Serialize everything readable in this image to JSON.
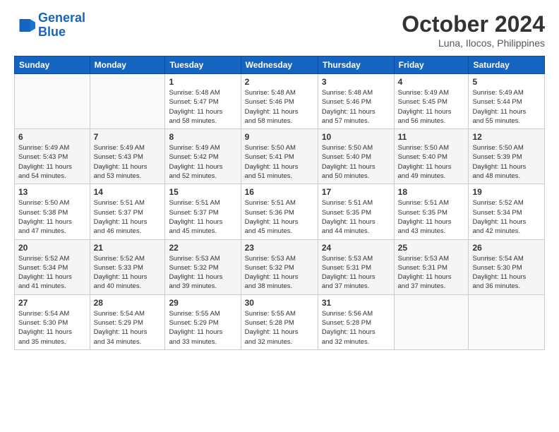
{
  "header": {
    "logo_line1": "General",
    "logo_line2": "Blue",
    "month": "October 2024",
    "location": "Luna, Ilocos, Philippines"
  },
  "weekdays": [
    "Sunday",
    "Monday",
    "Tuesday",
    "Wednesday",
    "Thursday",
    "Friday",
    "Saturday"
  ],
  "weeks": [
    [
      {
        "day": "",
        "info": ""
      },
      {
        "day": "",
        "info": ""
      },
      {
        "day": "1",
        "info": "Sunrise: 5:48 AM\nSunset: 5:47 PM\nDaylight: 11 hours\nand 58 minutes."
      },
      {
        "day": "2",
        "info": "Sunrise: 5:48 AM\nSunset: 5:46 PM\nDaylight: 11 hours\nand 58 minutes."
      },
      {
        "day": "3",
        "info": "Sunrise: 5:48 AM\nSunset: 5:46 PM\nDaylight: 11 hours\nand 57 minutes."
      },
      {
        "day": "4",
        "info": "Sunrise: 5:49 AM\nSunset: 5:45 PM\nDaylight: 11 hours\nand 56 minutes."
      },
      {
        "day": "5",
        "info": "Sunrise: 5:49 AM\nSunset: 5:44 PM\nDaylight: 11 hours\nand 55 minutes."
      }
    ],
    [
      {
        "day": "6",
        "info": "Sunrise: 5:49 AM\nSunset: 5:43 PM\nDaylight: 11 hours\nand 54 minutes."
      },
      {
        "day": "7",
        "info": "Sunrise: 5:49 AM\nSunset: 5:43 PM\nDaylight: 11 hours\nand 53 minutes."
      },
      {
        "day": "8",
        "info": "Sunrise: 5:49 AM\nSunset: 5:42 PM\nDaylight: 11 hours\nand 52 minutes."
      },
      {
        "day": "9",
        "info": "Sunrise: 5:50 AM\nSunset: 5:41 PM\nDaylight: 11 hours\nand 51 minutes."
      },
      {
        "day": "10",
        "info": "Sunrise: 5:50 AM\nSunset: 5:40 PM\nDaylight: 11 hours\nand 50 minutes."
      },
      {
        "day": "11",
        "info": "Sunrise: 5:50 AM\nSunset: 5:40 PM\nDaylight: 11 hours\nand 49 minutes."
      },
      {
        "day": "12",
        "info": "Sunrise: 5:50 AM\nSunset: 5:39 PM\nDaylight: 11 hours\nand 48 minutes."
      }
    ],
    [
      {
        "day": "13",
        "info": "Sunrise: 5:50 AM\nSunset: 5:38 PM\nDaylight: 11 hours\nand 47 minutes."
      },
      {
        "day": "14",
        "info": "Sunrise: 5:51 AM\nSunset: 5:37 PM\nDaylight: 11 hours\nand 46 minutes."
      },
      {
        "day": "15",
        "info": "Sunrise: 5:51 AM\nSunset: 5:37 PM\nDaylight: 11 hours\nand 45 minutes."
      },
      {
        "day": "16",
        "info": "Sunrise: 5:51 AM\nSunset: 5:36 PM\nDaylight: 11 hours\nand 45 minutes."
      },
      {
        "day": "17",
        "info": "Sunrise: 5:51 AM\nSunset: 5:35 PM\nDaylight: 11 hours\nand 44 minutes."
      },
      {
        "day": "18",
        "info": "Sunrise: 5:51 AM\nSunset: 5:35 PM\nDaylight: 11 hours\nand 43 minutes."
      },
      {
        "day": "19",
        "info": "Sunrise: 5:52 AM\nSunset: 5:34 PM\nDaylight: 11 hours\nand 42 minutes."
      }
    ],
    [
      {
        "day": "20",
        "info": "Sunrise: 5:52 AM\nSunset: 5:34 PM\nDaylight: 11 hours\nand 41 minutes."
      },
      {
        "day": "21",
        "info": "Sunrise: 5:52 AM\nSunset: 5:33 PM\nDaylight: 11 hours\nand 40 minutes."
      },
      {
        "day": "22",
        "info": "Sunrise: 5:53 AM\nSunset: 5:32 PM\nDaylight: 11 hours\nand 39 minutes."
      },
      {
        "day": "23",
        "info": "Sunrise: 5:53 AM\nSunset: 5:32 PM\nDaylight: 11 hours\nand 38 minutes."
      },
      {
        "day": "24",
        "info": "Sunrise: 5:53 AM\nSunset: 5:31 PM\nDaylight: 11 hours\nand 37 minutes."
      },
      {
        "day": "25",
        "info": "Sunrise: 5:53 AM\nSunset: 5:31 PM\nDaylight: 11 hours\nand 37 minutes."
      },
      {
        "day": "26",
        "info": "Sunrise: 5:54 AM\nSunset: 5:30 PM\nDaylight: 11 hours\nand 36 minutes."
      }
    ],
    [
      {
        "day": "27",
        "info": "Sunrise: 5:54 AM\nSunset: 5:30 PM\nDaylight: 11 hours\nand 35 minutes."
      },
      {
        "day": "28",
        "info": "Sunrise: 5:54 AM\nSunset: 5:29 PM\nDaylight: 11 hours\nand 34 minutes."
      },
      {
        "day": "29",
        "info": "Sunrise: 5:55 AM\nSunset: 5:29 PM\nDaylight: 11 hours\nand 33 minutes."
      },
      {
        "day": "30",
        "info": "Sunrise: 5:55 AM\nSunset: 5:28 PM\nDaylight: 11 hours\nand 32 minutes."
      },
      {
        "day": "31",
        "info": "Sunrise: 5:56 AM\nSunset: 5:28 PM\nDaylight: 11 hours\nand 32 minutes."
      },
      {
        "day": "",
        "info": ""
      },
      {
        "day": "",
        "info": ""
      }
    ]
  ]
}
